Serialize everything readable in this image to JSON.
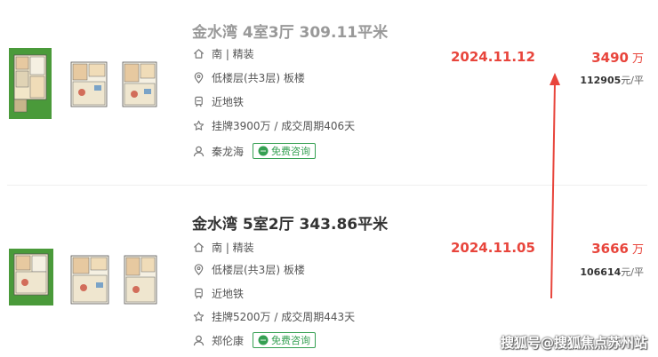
{
  "listings": [
    {
      "title": "金水湾 4室3厅 309.11平米",
      "orientation": "南 | 精装",
      "floor": "低楼层(共3层) 板楼",
      "subway": "近地铁",
      "listing_info": "挂牌3900万 / 成交周期406天",
      "agent": "秦龙海",
      "consult_label": "免费咨询",
      "deal_date": "2024.11.12",
      "total_price": "3490",
      "total_unit": "万",
      "unit_price": "112905",
      "unit_price_suffix": "元/平"
    },
    {
      "title": "金水湾 5室2厅 343.86平米",
      "orientation": "南 | 精装",
      "floor": "低楼层(共3层) 板楼",
      "subway": "近地铁",
      "listing_info": "挂牌5200万 / 成交周期443天",
      "agent": "郑伦康",
      "consult_label": "免费咨询",
      "deal_date": "2024.11.05",
      "total_price": "3666",
      "total_unit": "万",
      "unit_price": "106614",
      "unit_price_suffix": "元/平"
    }
  ],
  "watermark": "搜狐号@搜狐焦点苏州站",
  "colors": {
    "accent_red": "#e8453c",
    "consult_green": "#35a052",
    "title_gray": "#999999",
    "title_dark": "#333333"
  },
  "icons": [
    "home-icon",
    "location-pin-icon",
    "subway-icon",
    "star-icon",
    "person-icon",
    "chat-icon",
    "red-arrow-annotation"
  ]
}
